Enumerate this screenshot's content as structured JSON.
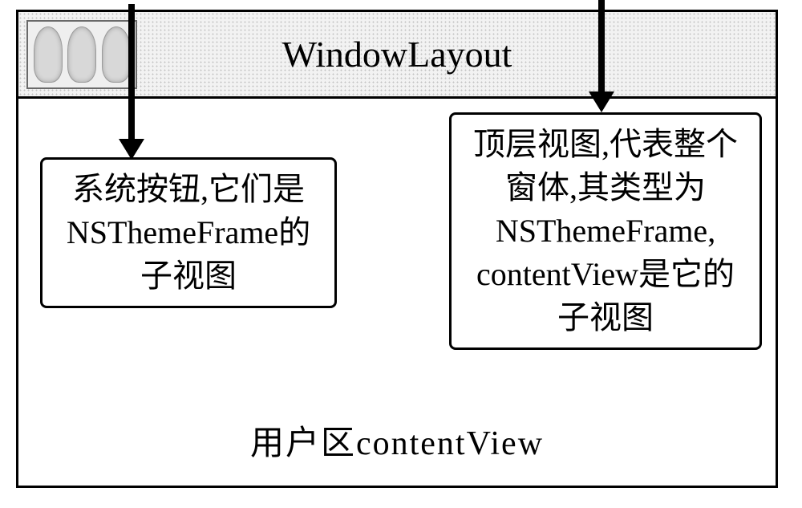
{
  "window": {
    "title": "WindowLayout"
  },
  "content": {
    "label": "用户区contentView"
  },
  "callouts": {
    "left": {
      "line1": "系统按钮,它们是",
      "line2": "NSThemeFrame的",
      "line3": "子视图"
    },
    "right": {
      "line1": "顶层视图,代表整个",
      "line2": "窗体,其类型为",
      "line3": "NSThemeFrame,",
      "line4": "contentView是它的",
      "line5": "子视图"
    }
  }
}
